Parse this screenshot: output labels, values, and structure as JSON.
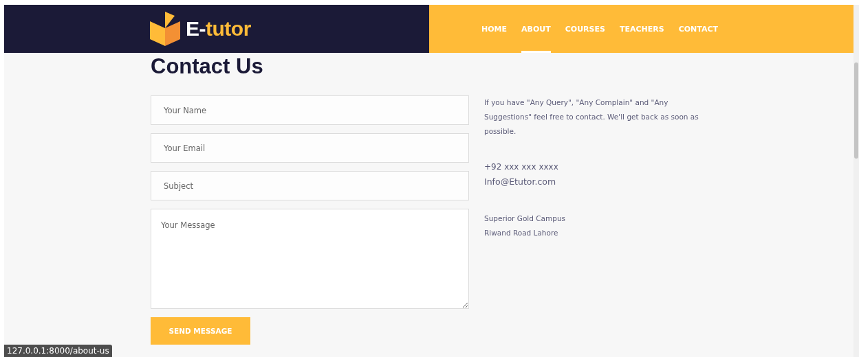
{
  "header": {
    "logo": {
      "text_first": "E-",
      "text_second": "tutor"
    },
    "nav": [
      {
        "label": "HOME",
        "selected": false
      },
      {
        "label": "ABOUT",
        "selected": true
      },
      {
        "label": "COURSES",
        "selected": false
      },
      {
        "label": "TEACHERS",
        "selected": false
      },
      {
        "label": "CONTACT",
        "selected": false
      }
    ]
  },
  "title": "Contact Us",
  "form": {
    "fields": [
      {
        "kind": "input",
        "placeholder": "Your Name"
      },
      {
        "kind": "input",
        "placeholder": "Your Email"
      },
      {
        "kind": "input",
        "placeholder": "Subject"
      },
      {
        "kind": "textarea",
        "placeholder": "Your Message"
      }
    ],
    "button": "SEND MESSAGE"
  },
  "info": {
    "intro": "If you have \"Any Query\", \"Any Complain\" and \"Any Suggestions\" feel free to contact. We'll get back as soon as possible.",
    "phone": "+92 xxx xxx xxxx",
    "email": "Info@Etutor.com",
    "address": [
      "Superior Gold Campus",
      "Riwand Road Lahore"
    ]
  },
  "status_bar": "127.0.0.1:8000/about-us"
}
